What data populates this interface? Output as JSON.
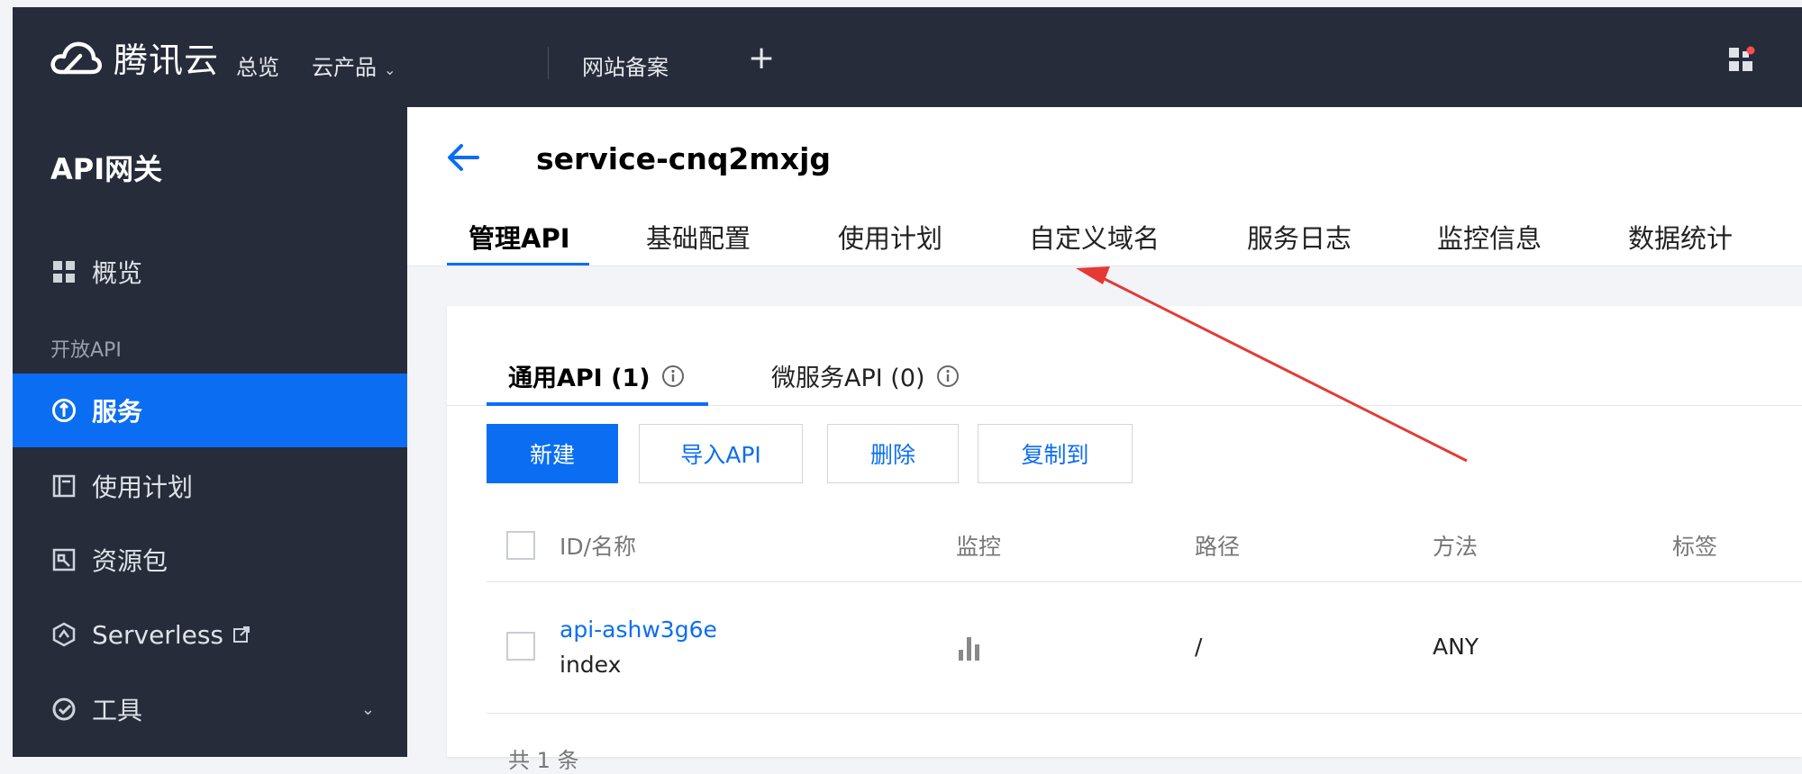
{
  "topbar": {
    "brand": "腾讯云",
    "nav": [
      "总览",
      "云产品",
      "网站备案"
    ],
    "plus": "+"
  },
  "sidebar": {
    "title": "API网关",
    "overview": "概览",
    "group_label": "开放API",
    "items": [
      {
        "label": "服务",
        "icon": "service-icon"
      },
      {
        "label": "使用计划",
        "icon": "plan-icon"
      },
      {
        "label": "资源包",
        "icon": "package-icon"
      },
      {
        "label": "Serverless",
        "icon": "serverless-icon"
      },
      {
        "label": "工具",
        "icon": "tools-icon"
      }
    ]
  },
  "header": {
    "service_name": "service-cnq2mxjg",
    "tabs": [
      "管理API",
      "基础配置",
      "使用计划",
      "自定义域名",
      "服务日志",
      "监控信息",
      "数据统计"
    ]
  },
  "card": {
    "subtabs": [
      "通用API (1)",
      "微服务API (0)"
    ],
    "buttons": {
      "new": "新建",
      "import": "导入API",
      "delete": "删除",
      "copy": "复制到"
    },
    "columns": [
      "ID/名称",
      "监控",
      "路径",
      "方法",
      "标签"
    ],
    "rows": [
      {
        "id": "api-ashw3g6e",
        "name": "index",
        "path": "/",
        "method": "ANY"
      }
    ],
    "footer": "共 1 条"
  },
  "colors": {
    "accent": "#0b6ef2",
    "topbar": "#262c3a",
    "annotation": "#e53935"
  }
}
